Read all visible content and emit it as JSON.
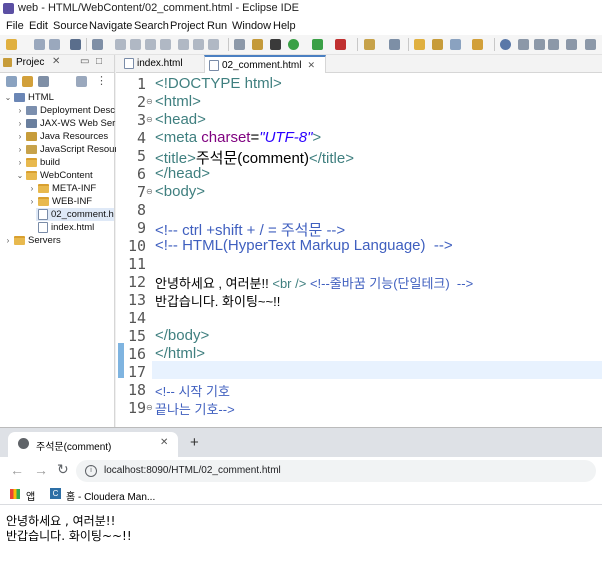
{
  "eclipse": {
    "title": "web - HTML/WebContent/02_comment.html - Eclipse IDE",
    "menu": [
      "File",
      "Edit",
      "Source",
      "Navigate",
      "Search",
      "Project",
      "Run",
      "Window",
      "Help"
    ],
    "explorer": {
      "tab_label": "Projec",
      "tree": [
        {
          "label": "HTML",
          "expanded": true
        },
        {
          "label": "Deployment Desc"
        },
        {
          "label": "JAX-WS Web Ser"
        },
        {
          "label": "Java Resources"
        },
        {
          "label": "JavaScript Resour"
        },
        {
          "label": "build"
        },
        {
          "label": "WebContent",
          "expanded": true
        },
        {
          "label": "META-INF"
        },
        {
          "label": "WEB-INF"
        },
        {
          "label": "02_comment.h",
          "selected": true
        },
        {
          "label": "index.html"
        },
        {
          "label": "Servers"
        }
      ]
    },
    "editor_tabs": [
      {
        "label": "index.html",
        "active": false
      },
      {
        "label": "02_comment.html",
        "active": true
      }
    ],
    "code": {
      "line_numbers": [
        "1",
        "2",
        "3",
        "4",
        "5",
        "6",
        "7",
        "8",
        "9",
        "10",
        "11",
        "12",
        "13",
        "14",
        "15",
        "16",
        "17",
        "18",
        "19"
      ],
      "l1": "<!DOCTYPE html>",
      "l2": "<html>",
      "l3": "<head>",
      "l4_tag_open": "<meta ",
      "l4_attr": "charset",
      "l4_eq": "=",
      "l4_val": "\"UTF-8\"",
      "l4_tag_close": ">",
      "l5_open": "<title>",
      "l5_text": "주석문(comment)",
      "l5_close": "</title>",
      "l6": "</head>",
      "l7": "<body>",
      "l9": "<!-- ctrl +shift + / = 주석문 -->",
      "l10": "<!-- HTML(HyperText Markup Language)  -->",
      "l12_text": "안녕하세요 , 여러분!! ",
      "l12_tag": "<br />",
      "l12_cmt": " <!--줄바꿈 기능(단일테크)  -->",
      "l13": "반갑습니다. 화이팅~~!!",
      "l15": "</body>",
      "l16": "</html>",
      "l18": "<!-- 시작 기호",
      "l19": "끝나는 기호-->"
    }
  },
  "browser": {
    "tab_title": "주석문(comment)",
    "new_tab": "+",
    "url": "localhost:8090/HTML/02_comment.html",
    "bookmarks": [
      {
        "label": "앱"
      },
      {
        "label": "홈 - Cloudera Man..."
      }
    ],
    "page_lines": [
      "안녕하세요 , 여러분!!",
      "반갑습니다. 화이팅~~!!"
    ]
  }
}
